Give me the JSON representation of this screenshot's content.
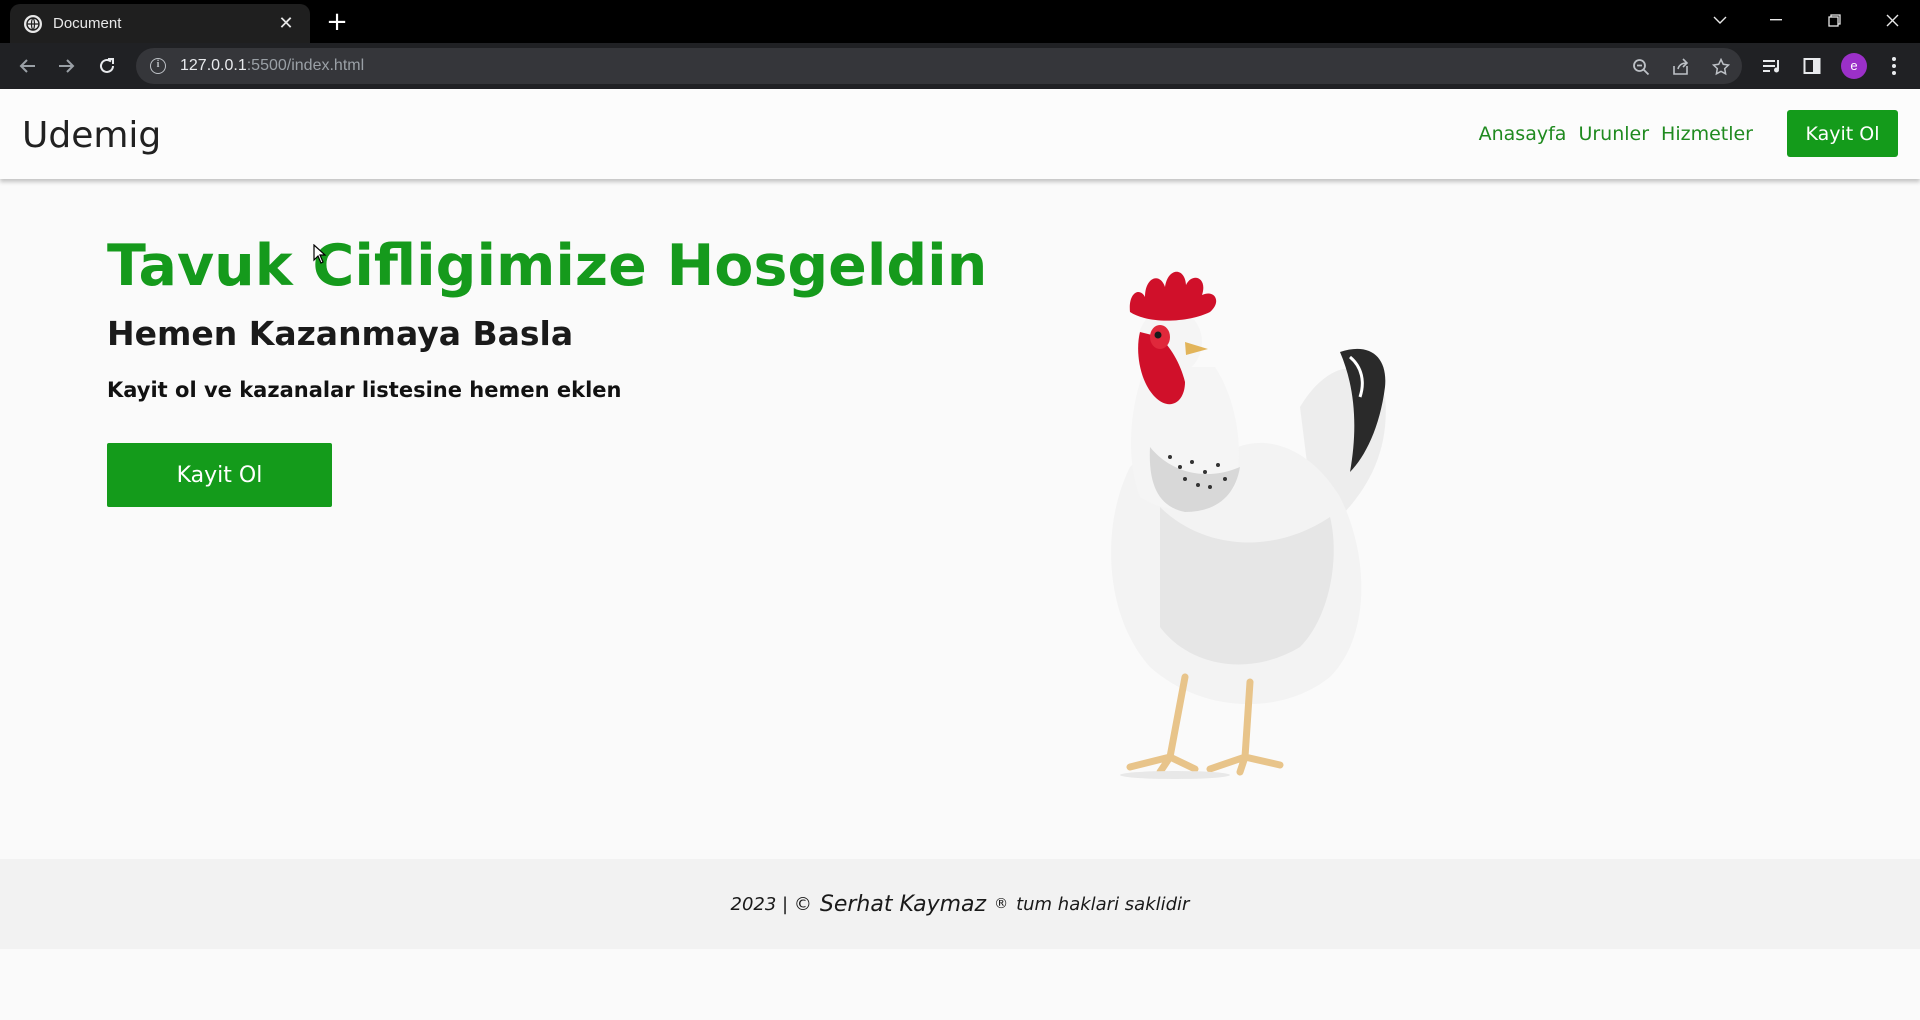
{
  "browser": {
    "tab_title": "Document",
    "url_host": "127.0.0.1",
    "url_rest": ":5500/index.html"
  },
  "navbar": {
    "brand": "Udemig",
    "links": [
      "Anasayfa",
      "Urunler",
      "Hizmetler"
    ],
    "cta_label": "Kayit Ol"
  },
  "hero": {
    "title": "Tavuk Cifligimize Hosgeldin",
    "subtitle": "Hemen Kazanmaya Basla",
    "description": "Kayit ol ve kazanalar listesine hemen eklen",
    "cta_label": "Kayit Ol"
  },
  "footer": {
    "year": "2023 | ©",
    "author": "Serhat Kaymaz",
    "reg": "®",
    "rights": "tum haklari saklidir"
  },
  "colors": {
    "accent": "#149b1b",
    "profile": "#9b30c9"
  },
  "profile_initial": "e"
}
